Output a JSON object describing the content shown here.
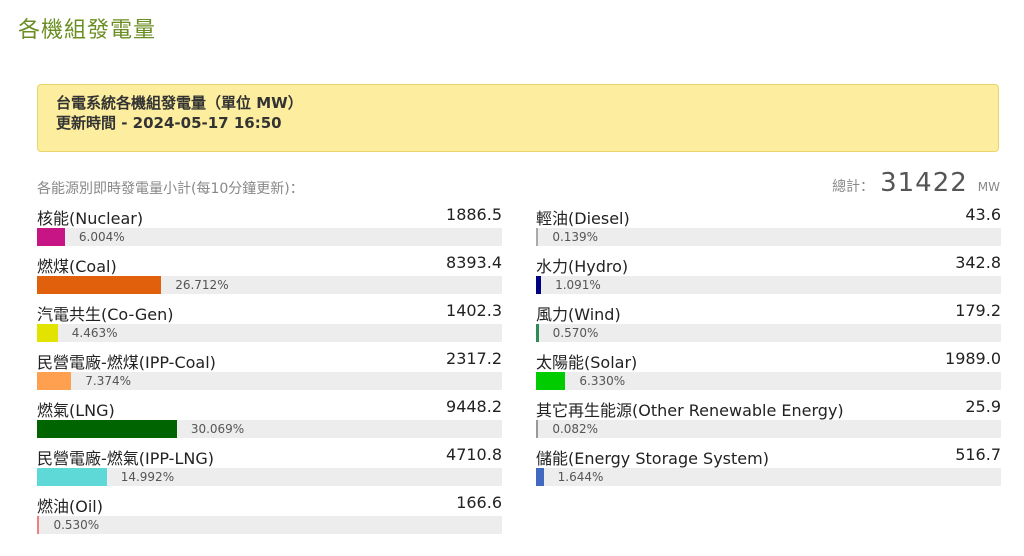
{
  "page_title": "各機組發電量",
  "info": {
    "line1": "台電系統各機組發電量（單位 MW）",
    "line2": "更新時間 - 2024-05-17 16:50"
  },
  "subtitle": "各能源別即時發電量小計(每10分鐘更新)：",
  "total": {
    "label": "總計：",
    "value": "31422",
    "unit": "MW"
  },
  "left_items": [
    {
      "name": "核能(Nuclear)",
      "value": "1886.5",
      "percent": "6.004%",
      "fraction": 0.06004,
      "color": "#c71585"
    },
    {
      "name": "燃煤(Coal)",
      "value": "8393.4",
      "percent": "26.712%",
      "fraction": 0.26712,
      "color": "#e0600b"
    },
    {
      "name": "汽電共生(Co-Gen)",
      "value": "1402.3",
      "percent": "4.463%",
      "fraction": 0.04463,
      "color": "#e3e300"
    },
    {
      "name": "民營電廠-燃煤(IPP-Coal)",
      "value": "2317.2",
      "percent": "7.374%",
      "fraction": 0.07374,
      "color": "#ffa050"
    },
    {
      "name": "燃氣(LNG)",
      "value": "9448.2",
      "percent": "30.069%",
      "fraction": 0.30069,
      "color": "#006400"
    },
    {
      "name": "民營電廠-燃氣(IPP-LNG)",
      "value": "4710.8",
      "percent": "14.992%",
      "fraction": 0.14992,
      "color": "#5fd8d8"
    },
    {
      "name": "燃油(Oil)",
      "value": "166.6",
      "percent": "0.530%",
      "fraction": 0.0053,
      "color": "#f08080"
    }
  ],
  "right_items": [
    {
      "name": "輕油(Diesel)",
      "value": "43.6",
      "percent": "0.139%",
      "fraction": 0.00139,
      "color": "#aaaaaa"
    },
    {
      "name": "水力(Hydro)",
      "value": "342.8",
      "percent": "1.091%",
      "fraction": 0.01091,
      "color": "#000080"
    },
    {
      "name": "風力(Wind)",
      "value": "179.2",
      "percent": "0.570%",
      "fraction": 0.0057,
      "color": "#2e8b57"
    },
    {
      "name": "太陽能(Solar)",
      "value": "1989.0",
      "percent": "6.330%",
      "fraction": 0.0633,
      "color": "#00cc00"
    },
    {
      "name": "其它再生能源(Other Renewable Energy)",
      "value": "25.9",
      "percent": "0.082%",
      "fraction": 0.00082,
      "color": "#999999"
    },
    {
      "name": "儲能(Energy Storage System)",
      "value": "516.7",
      "percent": "1.644%",
      "fraction": 0.01644,
      "color": "#4169c1"
    }
  ]
}
